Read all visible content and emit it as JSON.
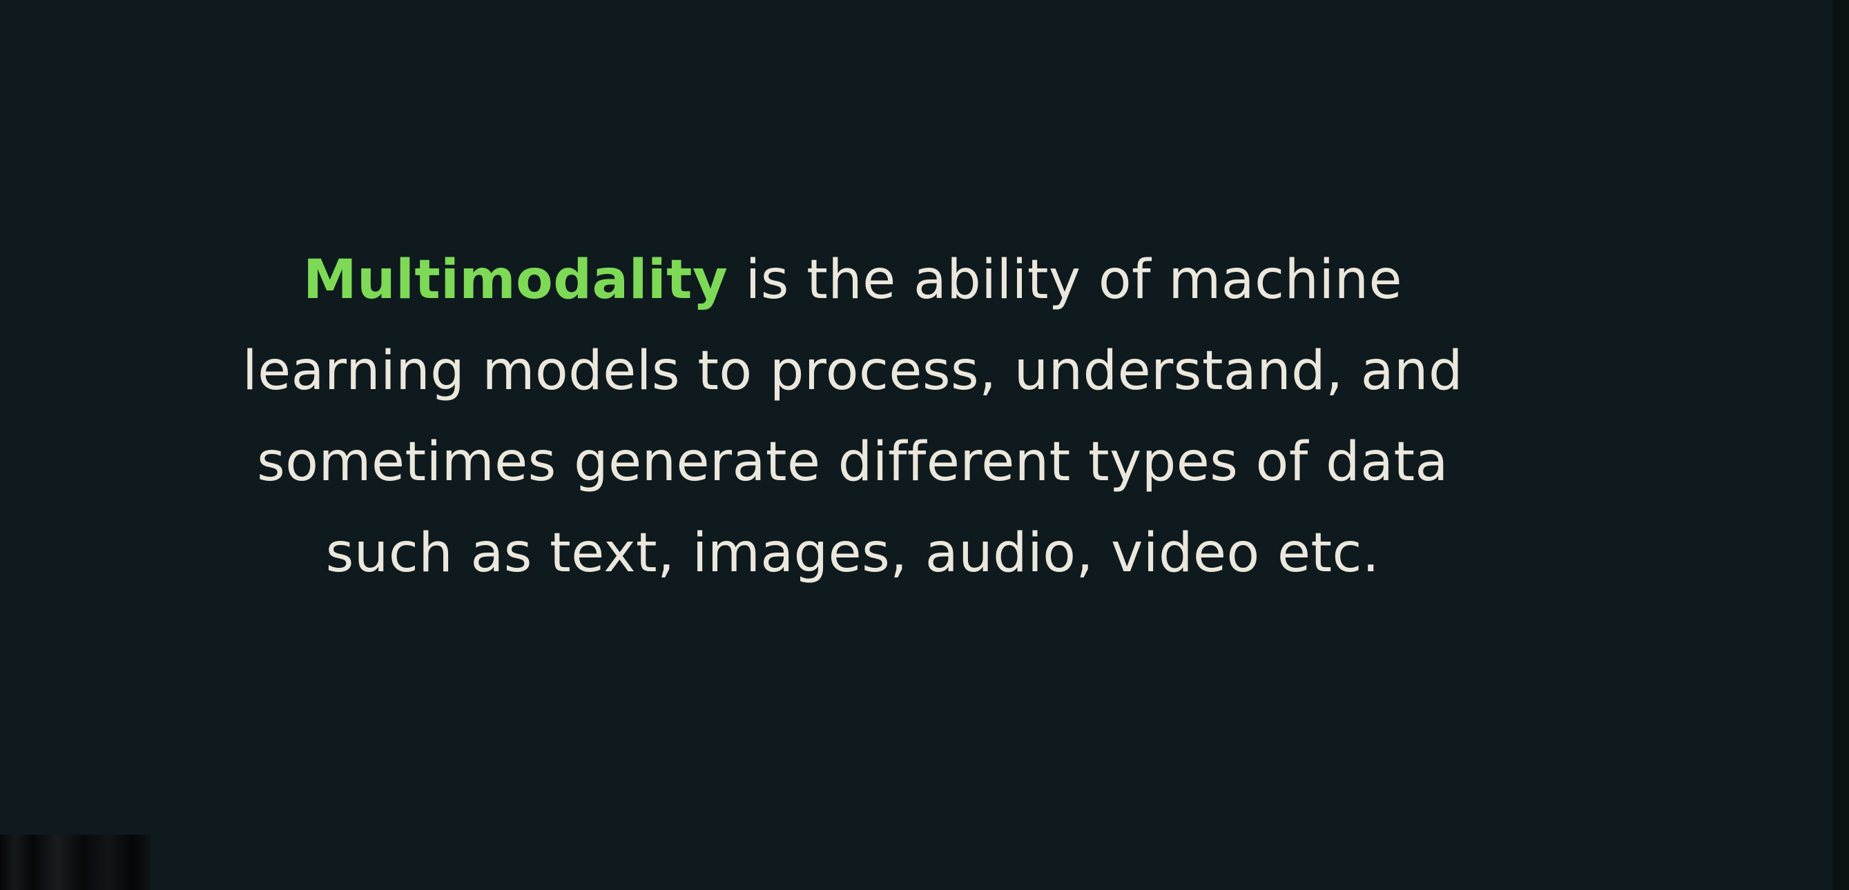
{
  "slide": {
    "highlight_term": "Multimodality",
    "line1_rest": " is the ability of machine",
    "line2": "learning models to process, understand, and",
    "line3": "sometimes generate different types of data",
    "line4": "such as text, images, audio, video etc.",
    "colors": {
      "background": "#0e1a1d",
      "text": "#ece7dc",
      "highlight": "#7ed957"
    }
  }
}
